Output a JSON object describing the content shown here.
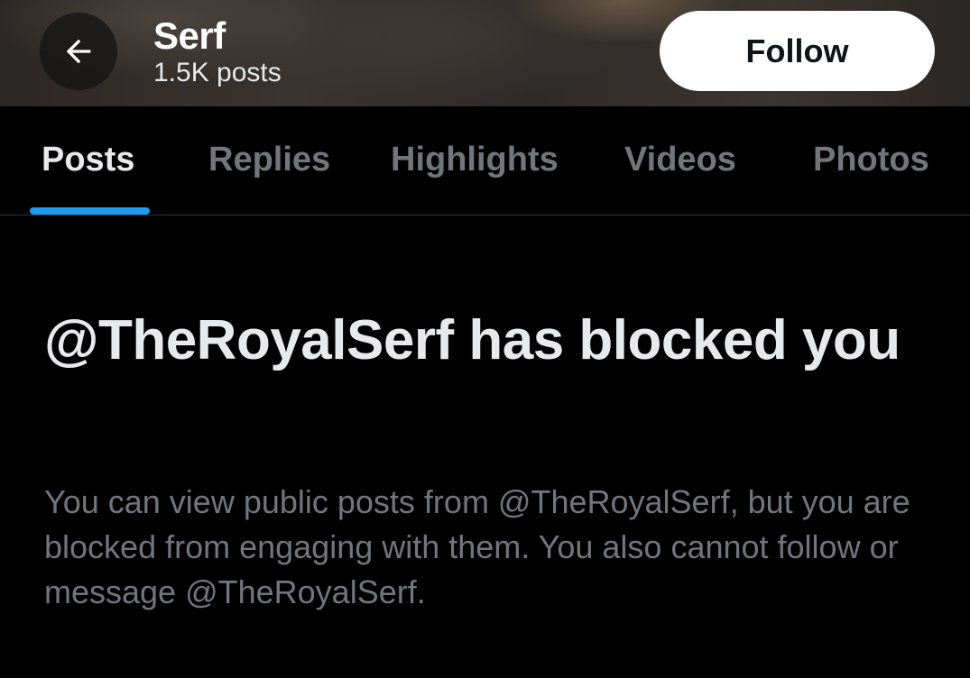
{
  "header": {
    "back_icon": "arrow-left-icon",
    "name": "Serf",
    "post_count": "1.5K posts",
    "follow_label": "Follow"
  },
  "tabs": [
    {
      "label": "Posts",
      "active": true
    },
    {
      "label": "Replies",
      "active": false
    },
    {
      "label": "Highlights",
      "active": false
    },
    {
      "label": "Videos",
      "active": false
    },
    {
      "label": "Photos",
      "active": false
    }
  ],
  "blocked": {
    "title": "@TheRoyalSerf has blocked you",
    "description": "You can view public posts from @TheRoyalSerf, but you are blocked from engaging with them. You also cannot follow or message @TheRoyalSerf."
  },
  "colors": {
    "background": "#000000",
    "accent": "#1d9bf0",
    "text_primary": "#e7e9ea",
    "text_secondary": "#71767b",
    "follow_button_bg": "#ffffff"
  }
}
